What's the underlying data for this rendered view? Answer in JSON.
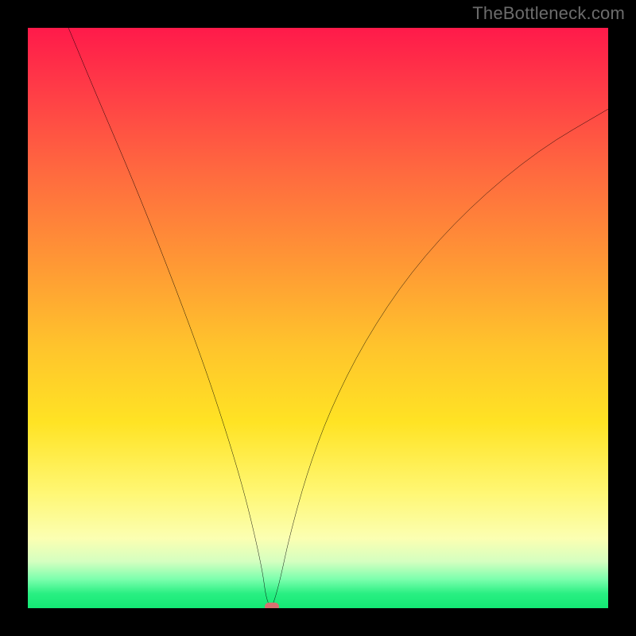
{
  "watermark": "TheBottleneck.com",
  "chart_data": {
    "type": "line",
    "title": "",
    "xlabel": "",
    "ylabel": "",
    "xlim": [
      0,
      100
    ],
    "ylim": [
      0,
      100
    ],
    "grid": false,
    "legend": false,
    "series": [
      {
        "name": "bottleneck-curve",
        "x": [
          7,
          12,
          18,
          24,
          30,
          34,
          37,
          39,
          40.5,
          41,
          41.8,
          42.4,
          43.5,
          45,
          48,
          52,
          58,
          66,
          76,
          88,
          100
        ],
        "y": [
          100,
          88,
          74,
          59,
          43,
          31,
          21,
          13,
          6,
          2,
          0,
          1,
          5,
          12,
          23,
          34,
          46,
          58,
          69,
          79,
          86
        ]
      }
    ],
    "markers": [
      {
        "name": "min-point",
        "x": 42,
        "y": 0
      }
    ],
    "background_gradient": {
      "direction": "top-to-bottom",
      "stops": [
        {
          "pos": 0,
          "color": "#ff1a4a"
        },
        {
          "pos": 0.25,
          "color": "#ff6a3f"
        },
        {
          "pos": 0.55,
          "color": "#ffc42c"
        },
        {
          "pos": 0.8,
          "color": "#fff773"
        },
        {
          "pos": 0.95,
          "color": "#7cffad"
        },
        {
          "pos": 1.0,
          "color": "#13e874"
        }
      ]
    }
  },
  "colors": {
    "curve": "#000000",
    "dot": "#d87070",
    "frame": "#000000"
  }
}
